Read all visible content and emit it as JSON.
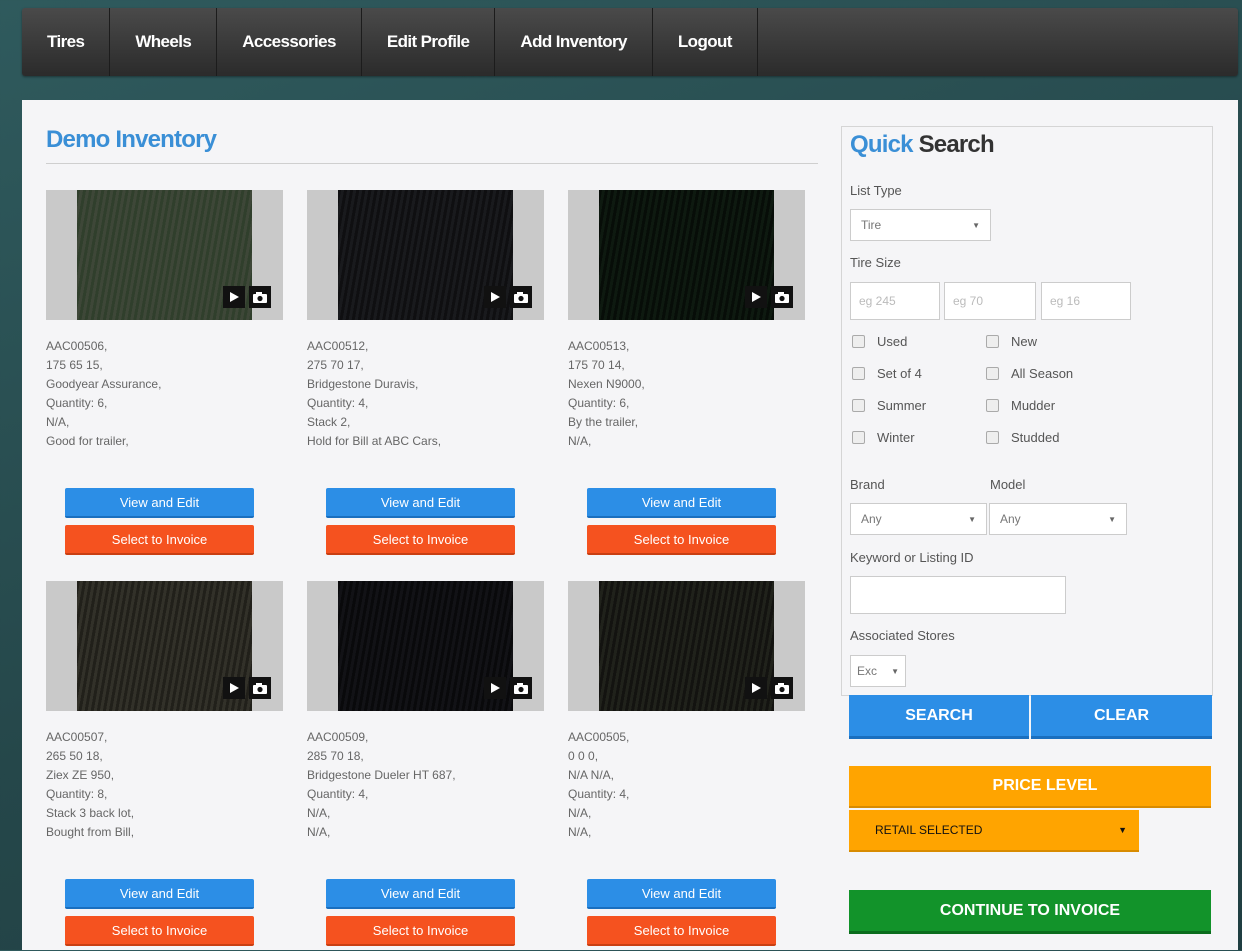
{
  "nav": [
    "Tires",
    "Wheels",
    "Accessories",
    "Edit Profile",
    "Add Inventory",
    "Logout"
  ],
  "inventory": {
    "title": "Demo Inventory",
    "view_label": "View and Edit",
    "select_label": "Select to Invoice",
    "items": [
      {
        "lines": [
          "AAC00506,",
          "175 65 15,",
          "Goodyear Assurance,",
          "Quantity: 6,",
          "N/A,",
          "Good for trailer,"
        ]
      },
      {
        "lines": [
          "AAC00512,",
          "275 70 17,",
          "Bridgestone Duravis,",
          "Quantity: 4,",
          "Stack 2,",
          "Hold for Bill at ABC Cars,"
        ]
      },
      {
        "lines": [
          "AAC00513,",
          "175 70 14,",
          "Nexen N9000,",
          "Quantity: 6,",
          "By the trailer,",
          "N/A,"
        ]
      },
      {
        "lines": [
          "AAC00507,",
          "265 50 18,",
          "Ziex ZE 950,",
          "Quantity: 8,",
          "Stack 3 back lot,",
          "Bought from Bill,"
        ]
      },
      {
        "lines": [
          "AAC00509,",
          "285 70 18,",
          "Bridgestone Dueler HT 687,",
          "Quantity: 4,",
          "N/A,",
          "N/A,"
        ]
      },
      {
        "lines": [
          "AAC00505,",
          "0 0 0,",
          "N/A N/A,",
          "Quantity: 4,",
          "N/A,",
          "N/A,"
        ]
      }
    ]
  },
  "quick_search": {
    "title_accent": "Quick",
    "title_rest": "Search",
    "list_type_label": "List Type",
    "list_type_value": "Tire",
    "tire_size_label": "Tire Size",
    "size_placeholders": [
      "eg 245",
      "eg 70",
      "eg 16"
    ],
    "checkboxes": [
      "Used",
      "New",
      "Set of 4",
      "All Season",
      "Summer",
      "Mudder",
      "Winter",
      "Studded"
    ],
    "brand_label": "Brand",
    "model_label": "Model",
    "brand_value": "Any",
    "model_value": "Any",
    "keyword_label": "Keyword or Listing ID",
    "stores_label": "Associated Stores",
    "stores_value": "Exc",
    "search_label": "SEARCH",
    "clear_label": "CLEAR"
  },
  "price_level": {
    "label": "PRICE LEVEL",
    "selected": "RETAIL SELECTED"
  },
  "continue_label": "CONTINUE TO INVOICE",
  "colors": {
    "accent": "#3a8fd6",
    "view_button": "#2c8ee6",
    "select_button": "#f5521f",
    "price": "#ffa400",
    "continue": "#12932a"
  }
}
